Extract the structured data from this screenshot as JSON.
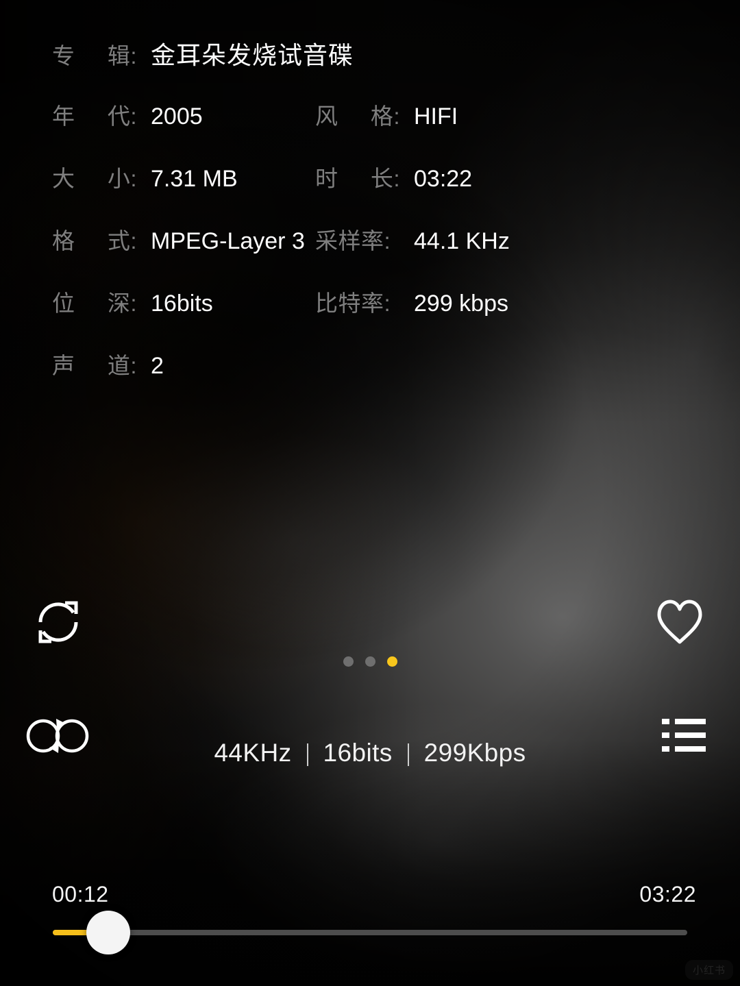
{
  "meta": {
    "rows": [
      {
        "left": {
          "label": "专辑:",
          "label_chars": [
            "专",
            "辑:"
          ],
          "value": "金耳朵发烧试音碟",
          "cjk": true
        },
        "right": null
      },
      {
        "left": {
          "label": "年代:",
          "label_chars": [
            "年",
            "代:"
          ],
          "value": "2005"
        },
        "right": {
          "label": "风格:",
          "label_chars": [
            "风",
            "格:"
          ],
          "value": "HIFI"
        }
      },
      {
        "left": {
          "label": "大小:",
          "label_chars": [
            "大",
            "小:"
          ],
          "value": "7.31 MB"
        },
        "right": {
          "label": "时长:",
          "label_chars": [
            "时",
            "长:"
          ],
          "value": "03:22"
        }
      },
      {
        "left": {
          "label": "格式:",
          "label_chars": [
            "格",
            "式:"
          ],
          "value": "MPEG-Layer 3"
        },
        "right": {
          "label": "采样率:",
          "label_solid": "采样率:",
          "value": "44.1 KHz"
        }
      },
      {
        "left": {
          "label": "位深:",
          "label_chars": [
            "位",
            "深:"
          ],
          "value": "16bits"
        },
        "right": {
          "label": "比特率:",
          "label_solid": "比特率:",
          "value": "299 kbps"
        }
      },
      {
        "left": {
          "label": "声道:",
          "label_chars": [
            "声",
            "道:"
          ],
          "value": "2"
        },
        "right": null
      }
    ]
  },
  "controls": {
    "repeat": {
      "icon": "repeat-circle-icon",
      "label": "单曲循环"
    },
    "favorite": {
      "icon": "heart-outline-icon",
      "label": "收藏"
    },
    "ab_repeat": {
      "icon": "ab-loop-infinity-icon",
      "label": "AB循环"
    },
    "playlist": {
      "icon": "playlist-list-icon",
      "label": "播放列表"
    }
  },
  "pager": {
    "count": 3,
    "active_index": 2,
    "active_color": "#f8c61c",
    "inactive_color": "#6f6f6f"
  },
  "quality": {
    "sample_rate": "44KHz",
    "bit_depth": "16bits",
    "bitrate": "299Kbps",
    "separator": "|"
  },
  "progress": {
    "elapsed": "00:12",
    "total": "03:22",
    "percent": 8.8,
    "fill_color": "#f6bf1b",
    "track_color": "#4d4d4d",
    "thumb_color": "#f4f4f4"
  },
  "watermark": {
    "text": "小红书"
  }
}
